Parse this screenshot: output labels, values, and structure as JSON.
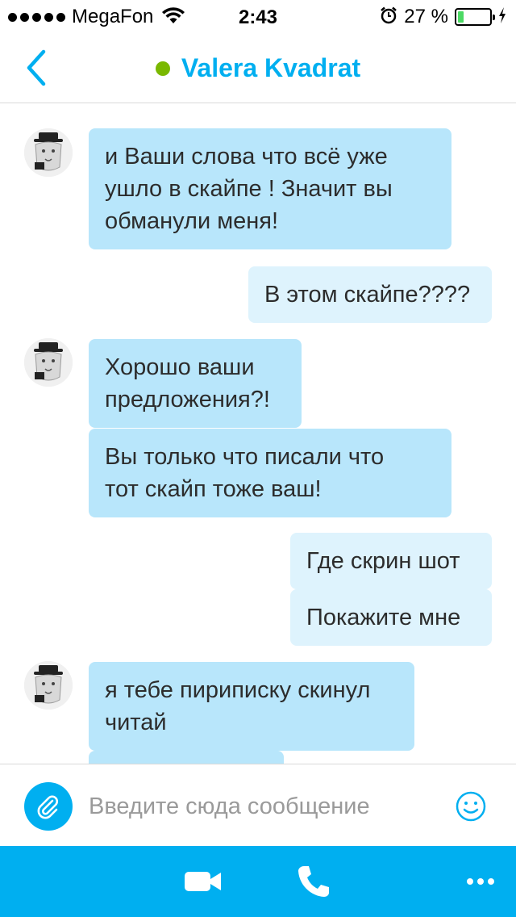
{
  "status_bar": {
    "carrier": "MegaFon",
    "time": "2:43",
    "battery_percent": "27 %",
    "battery_level": 0.27,
    "icons": [
      "signal-dots-icon",
      "wifi-icon",
      "alarm-icon",
      "battery-icon",
      "charging-bolt-icon"
    ]
  },
  "nav": {
    "back_icon": "chevron-left-icon",
    "contact_name": "Valera Kvadrat",
    "presence": "online",
    "presence_color": "#7ab800"
  },
  "messages": [
    {
      "direction": "incoming",
      "text": "и Ваши слова что всё уже\nушло в скайпе ! Значит вы\nобманули меня!"
    },
    {
      "direction": "outgoing",
      "text": "В этом скайпе????"
    },
    {
      "direction": "incoming",
      "text": "Хорошо ваши\nпредложения?!"
    },
    {
      "direction": "incoming",
      "text": "Вы только что писали что\nтот скайп тоже ваш!"
    },
    {
      "direction": "outgoing",
      "text": "Где скрин шот"
    },
    {
      "direction": "outgoing",
      "text": "Покажите мне"
    },
    {
      "direction": "incoming",
      "text": "я тебе пирипиcку скинул\nчитай"
    },
    {
      "direction": "incoming",
      "text": ""
    }
  ],
  "input": {
    "placeholder": "Введите сюда сообщение",
    "value": ""
  },
  "toolbar": {
    "icons": [
      "video-call-icon",
      "phone-call-icon",
      "more-options-icon"
    ]
  },
  "colors": {
    "accent": "#00aff0",
    "incoming_bubble": "#b8e6fb",
    "outgoing_bubble": "#def3fd",
    "battery_fill": "#4cd964"
  }
}
